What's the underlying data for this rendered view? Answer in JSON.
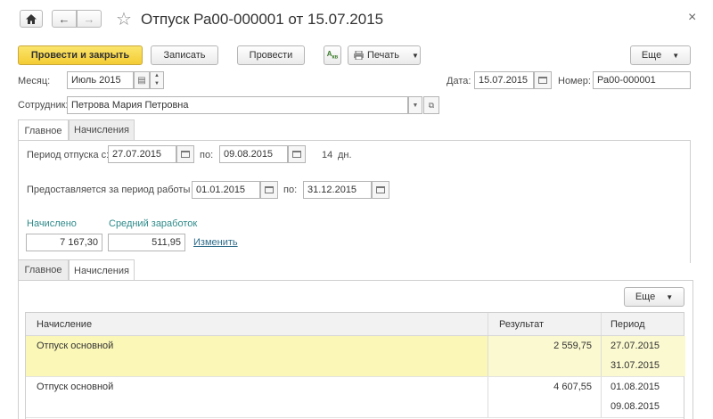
{
  "window": {
    "title": "Отпуск Ра00-000001 от 15.07.2015",
    "close_glyph": "×",
    "star_glyph": "☆"
  },
  "toolbar": {
    "post_close": "Провести и закрыть",
    "save": "Записать",
    "post": "Провести",
    "print": "Печать",
    "more": "Еще"
  },
  "header": {
    "month_label": "Месяц:",
    "month_value": "Июль 2015",
    "date_label": "Дата:",
    "date_value": "15.07.2015",
    "number_label": "Номер:",
    "number_value": "Ра00-000001",
    "employee_label": "Сотрудник:",
    "employee_value": "Петрова Мария Петровна"
  },
  "tabs_top": [
    {
      "label": "Главное",
      "active": true
    },
    {
      "label": "Начисления",
      "active": false
    }
  ],
  "main": {
    "vacation_period_label": "Период отпуска с:",
    "vacation_from": "27.07.2015",
    "to_label": "по:",
    "vacation_to": "09.08.2015",
    "days_value": "14",
    "days_unit": "дн.",
    "work_period_label": "Предоставляется за период работы с:",
    "work_from": "01.01.2015",
    "work_to_label": "по:",
    "work_to": "31.12.2015",
    "accrued_label": "Начислено",
    "accrued_value": "7 167,30",
    "avg_label": "Средний заработок",
    "avg_value": "511,95",
    "change_link": "Изменить"
  },
  "tabs_bottom": [
    {
      "label": "Главное",
      "active": false
    },
    {
      "label": "Начисления",
      "active": true
    }
  ],
  "grid": {
    "more": "Еще",
    "columns": [
      "Начисление",
      "Результат",
      "Период"
    ],
    "rows": [
      {
        "name": "Отпуск основной",
        "result": "2 559,75",
        "period_from": "27.07.2015",
        "period_to": "31.07.2015",
        "selected": true
      },
      {
        "name": "Отпуск основной",
        "result": "4 607,55",
        "period_from": "01.08.2015",
        "period_to": "09.08.2015",
        "selected": false
      }
    ]
  }
}
